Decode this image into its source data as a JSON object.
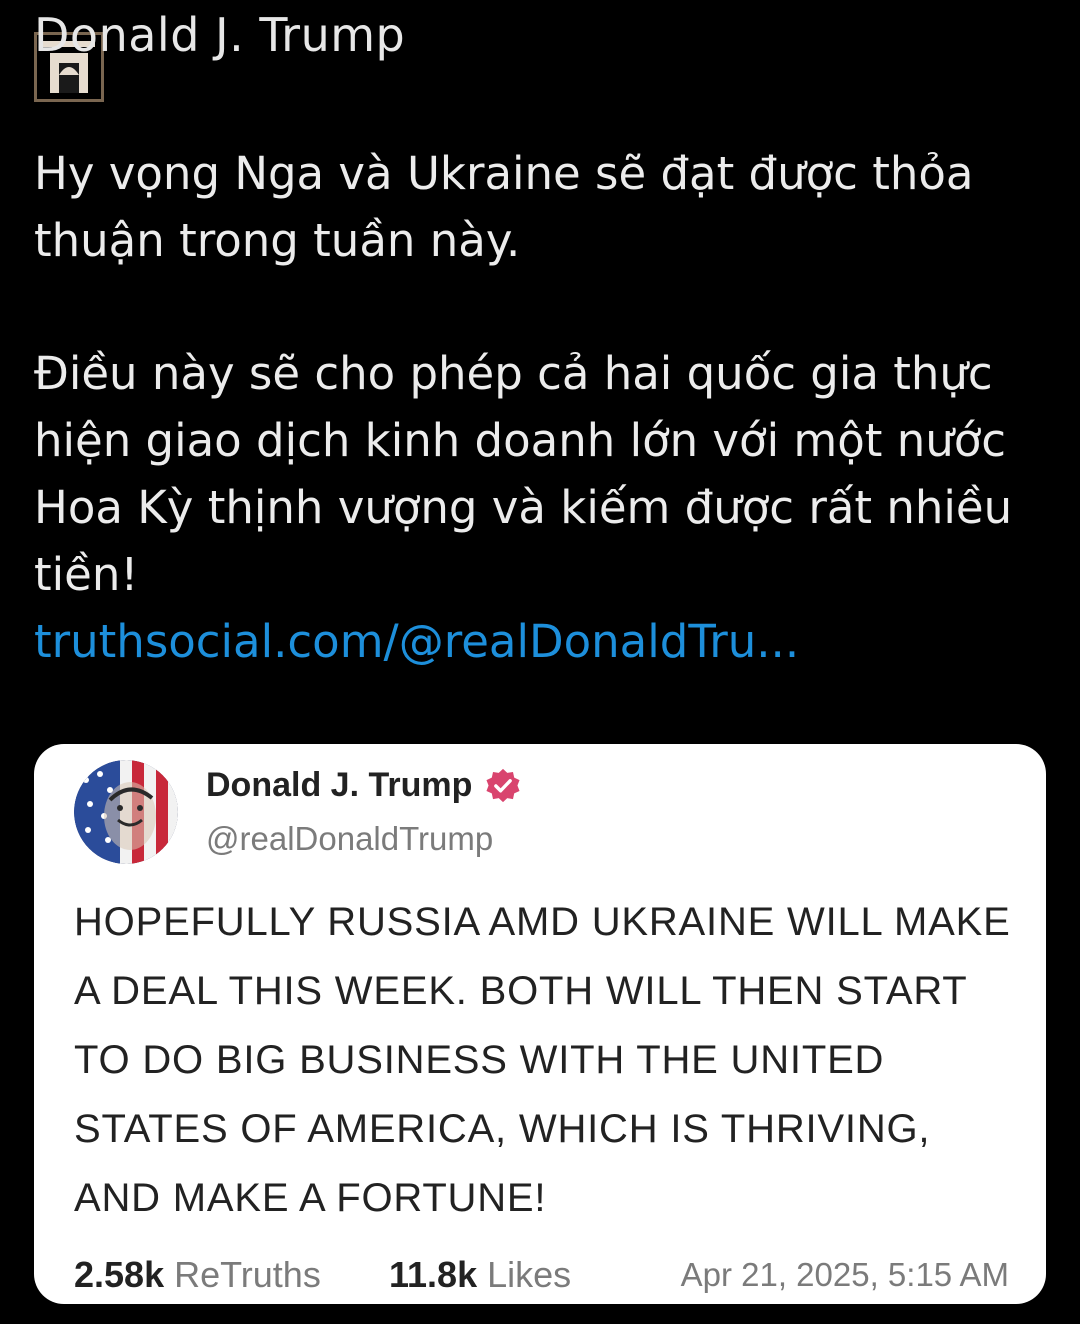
{
  "post": {
    "author_name": "Donald J. Trump",
    "paragraph_1": "Hy vọng Nga và Ukraine sẽ đạt được thỏa thuận trong tuần này.",
    "paragraph_2": "Điều này sẽ cho phép cả hai quốc gia thực hiện giao dịch kinh doanh lớn với một nước Hoa Kỳ thịnh vượng và kiếm được rất nhiều tiền!",
    "link_text": "truthsocial.com/@realDonaldTru...",
    "link_color": "#1d8fdb"
  },
  "embedded_card": {
    "author_name": "Donald J. Trump",
    "handle": "@realDonaldTrump",
    "verified_icon": "verified-badge-icon",
    "verified_color": "#d9446e",
    "text": "HOPEFULLY RUSSIA AMD UKRAINE WILL MAKE A DEAL THIS WEEK. BOTH WILL THEN START TO DO BIG BUSINESS WITH THE UNITED STATES OF AMERICA, WHICH IS THRIVING, AND MAKE A FORTUNE!",
    "retruths_count": "2.58k",
    "retruths_label": "ReTruths",
    "likes_count": "11.8k",
    "likes_label": "Likes",
    "timestamp": "Apr 21, 2025, 5:15 AM"
  },
  "colors": {
    "background": "#000000",
    "card_background": "#ffffff"
  }
}
